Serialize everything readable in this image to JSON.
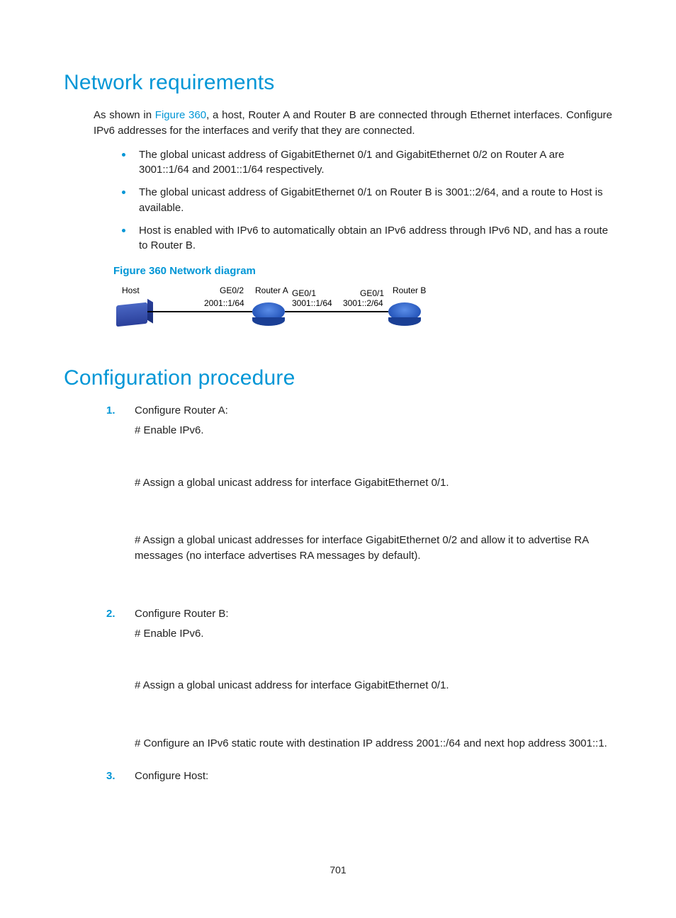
{
  "section1": {
    "title": "Network requirements",
    "intro_pre": "As shown in ",
    "intro_link": "Figure 360",
    "intro_post": ", a host, Router A and Router B are connected through Ethernet interfaces. Configure IPv6 addresses for the interfaces and verify that they are connected.",
    "bullets": [
      "The global unicast address of GigabitEthernet 0/1 and GigabitEthernet 0/2 on Router A are 3001::1/64 and 2001::1/64 respectively.",
      "The global unicast address of GigabitEthernet 0/1 on Router B is 3001::2/64, and a route to Host is available.",
      "Host is enabled with IPv6 to automatically obtain an IPv6 address through IPv6 ND, and has a route to Router B."
    ],
    "figure_caption": "Figure 360 Network diagram"
  },
  "diagram": {
    "host": "Host",
    "routerA": "Router A",
    "routerB": "Router B",
    "ge02": "GE0/2",
    "ge01_a": "GE0/1",
    "ge01_b": "GE0/1",
    "addr_2001": "2001::1/64",
    "addr_3001_1": "3001::1/64",
    "addr_3001_2": "3001::2/64"
  },
  "section2": {
    "title": "Configuration procedure",
    "steps": [
      {
        "head": "Configure Router A:",
        "lines": [
          "# Enable IPv6.",
          "# Assign a global unicast address for interface GigabitEthernet 0/1.",
          "# Assign a global unicast addresses for interface GigabitEthernet 0/2 and allow it to advertise RA messages (no interface advertises RA messages by default)."
        ]
      },
      {
        "head": "Configure Router B:",
        "lines": [
          "# Enable IPv6.",
          "# Assign a global unicast address for interface GigabitEthernet 0/1.",
          "# Configure an IPv6 static route with destination IP address 2001::/64 and next hop address 3001::1."
        ]
      },
      {
        "head": "Configure Host:",
        "lines": []
      }
    ]
  },
  "page_number": "701"
}
